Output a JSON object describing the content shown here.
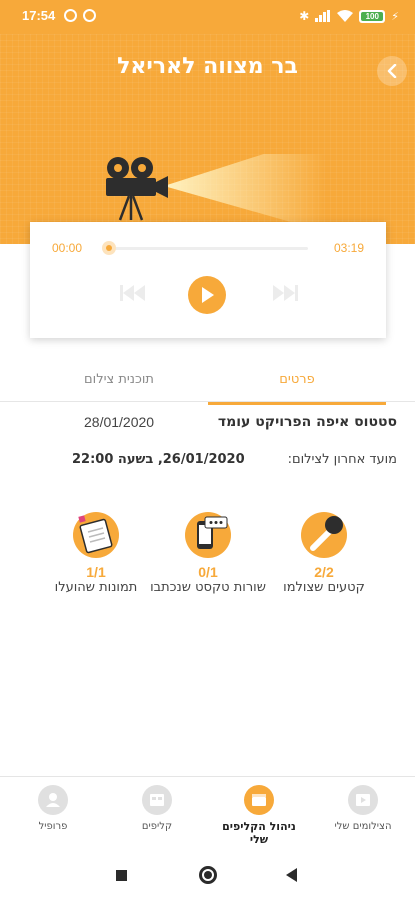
{
  "status_bar": {
    "time": "17:54",
    "battery": "100"
  },
  "header": {
    "title": "בר מצווה לאריאל"
  },
  "player": {
    "current_time": "00:00",
    "duration": "03:19",
    "progress": 0
  },
  "tabs": {
    "details": "פרטים",
    "schedule": "תוכנית צילום"
  },
  "details": {
    "status_label": "סטטוס איפה הפרויקט עומד",
    "status_date": "28/01/2020",
    "deadline_label": "מועד אחרון לצילום:",
    "deadline_value": "26/01/2020, בשעה 22:00"
  },
  "stats": [
    {
      "count": "2/2",
      "label": "קטעים שצולמו",
      "icon": "microphone-icon"
    },
    {
      "count": "0/1",
      "label": "שורות טקסט שנכתבו",
      "icon": "phone-chat-icon"
    },
    {
      "count": "1/1",
      "label": "תמונות שהועלו",
      "icon": "notepad-icon"
    }
  ],
  "bottom_nav": [
    {
      "label": "הצילומים שלי",
      "icon": "video-library-icon"
    },
    {
      "label": "ניהול הקליפים שלי",
      "icon": "clip-manage-icon",
      "active": true
    },
    {
      "label": "קליפים",
      "icon": "clips-icon"
    },
    {
      "label": "פרופיל",
      "icon": "profile-icon"
    }
  ],
  "colors": {
    "accent": "#f7a93a"
  }
}
